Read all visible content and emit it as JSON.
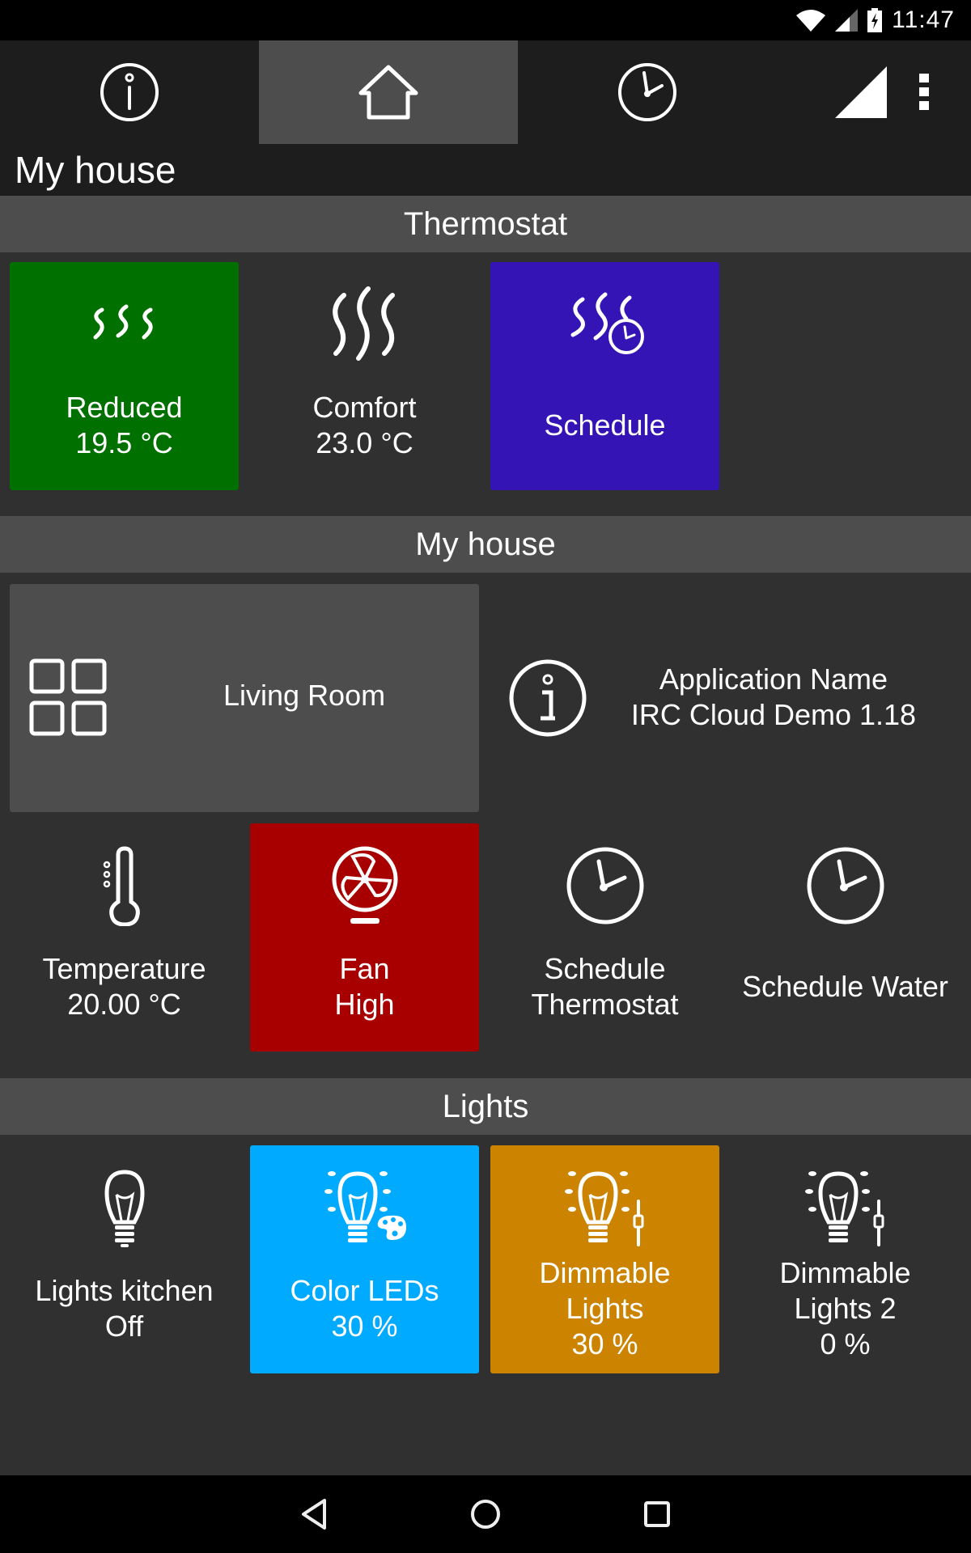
{
  "status_bar": {
    "time": "11:47",
    "icons": [
      "wifi-icon",
      "cell-signal-icon",
      "battery-charging-icon"
    ]
  },
  "toolbar": {
    "tabs": [
      {
        "name": "info",
        "icon": "info-icon",
        "active": false
      },
      {
        "name": "home",
        "icon": "home-icon",
        "active": true
      },
      {
        "name": "schedule",
        "icon": "clock-icon",
        "active": false
      }
    ],
    "right_icons": [
      "signal-strength-icon",
      "overflow-menu-icon"
    ]
  },
  "page": {
    "title": "My house"
  },
  "sections": {
    "thermostat": {
      "title": "Thermostat",
      "tiles": [
        {
          "label": "Reduced",
          "value": "19.5 °C",
          "icon": "heat-waves-small-icon",
          "color": "#007000"
        },
        {
          "label": "Comfort",
          "value": "23.0 °C",
          "icon": "heat-waves-icon",
          "color": ""
        },
        {
          "label": "Schedule",
          "value": "",
          "icon": "heat-schedule-icon",
          "color": "#3414b4"
        }
      ]
    },
    "my_house": {
      "title": "My house",
      "living_room": {
        "label": "Living Room",
        "icon": "rooms-grid-icon",
        "color": "#4d4d4d"
      },
      "app_info": {
        "label": "Application Name",
        "value": "IRC Cloud Demo 1.18",
        "icon": "info-icon"
      },
      "tiles": [
        {
          "label": "Temperature",
          "value": "20.00 °C",
          "icon": "thermometer-icon",
          "color": ""
        },
        {
          "label": "Fan",
          "value": "High",
          "icon": "fan-icon",
          "color": "#a80000"
        },
        {
          "label": "Schedule",
          "label2": "Thermostat",
          "icon": "clock-icon",
          "color": ""
        },
        {
          "label": "Schedule Water",
          "icon": "clock-icon",
          "color": ""
        }
      ]
    },
    "lights": {
      "title": "Lights",
      "tiles": [
        {
          "label": "Lights kitchen",
          "value": "Off",
          "icon": "light-bulb-icon",
          "color": ""
        },
        {
          "label": "Color LEDs",
          "value": "30 %",
          "icon": "color-bulb-icon",
          "color": "#00aaff"
        },
        {
          "label": "Dimmable",
          "label2": "Lights",
          "value": "30 %",
          "icon": "dimmable-bulb-icon",
          "color": "#cc8400"
        },
        {
          "label": "Dimmable",
          "label2": "Lights 2",
          "value": "0 %",
          "icon": "dimmable-bulb-icon",
          "color": ""
        }
      ]
    }
  },
  "nav_bar": {
    "buttons": [
      "back",
      "home",
      "recents"
    ]
  }
}
